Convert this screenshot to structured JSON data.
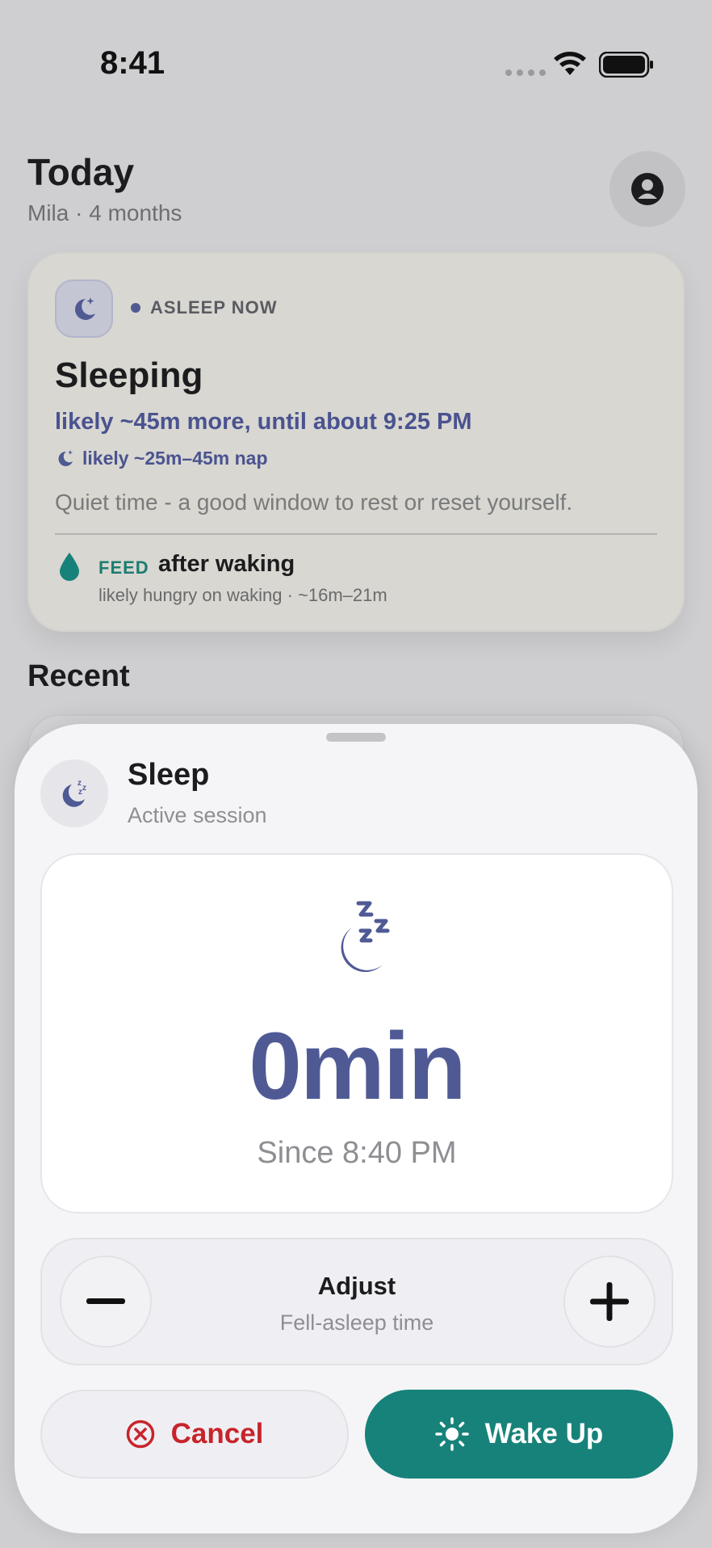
{
  "status_bar": {
    "time": "8:41",
    "icons": [
      "signal-dots-icon",
      "wifi-icon",
      "battery-icon"
    ]
  },
  "header": {
    "title": "Today",
    "subtitle": "Mila · 4 months",
    "avatar_icon": "person-icon"
  },
  "now_card": {
    "icon": "moon-stars-icon",
    "status_label": "ASLEEP NOW",
    "title": "Sleeping",
    "eta": "likely ~45m more, until about 9:25 PM",
    "nap_estimate": "likely ~25m–45m nap",
    "tip": "Quiet time - a good window to rest or reset yourself.",
    "next": {
      "icon": "drop-icon",
      "tag": "FEED",
      "title": "after waking",
      "detail": "likely hungry on waking · ~16m–21m"
    }
  },
  "recent": {
    "title": "Recent"
  },
  "sheet": {
    "icon": "moon-zzz-icon",
    "title": "Sleep",
    "subtitle": "Active session",
    "timer": {
      "value": "0min",
      "since": "Since 8:40 PM"
    },
    "adjust": {
      "title": "Adjust",
      "subtitle": "Fell-asleep time",
      "minus_icon": "minus-icon",
      "plus_icon": "plus-icon"
    },
    "actions": {
      "cancel_label": "Cancel",
      "wake_label": "Wake Up"
    }
  },
  "colors": {
    "accent": "#4f5a95",
    "teal": "#17827a",
    "danger": "#c8242b",
    "background": "#cfcfd1"
  }
}
